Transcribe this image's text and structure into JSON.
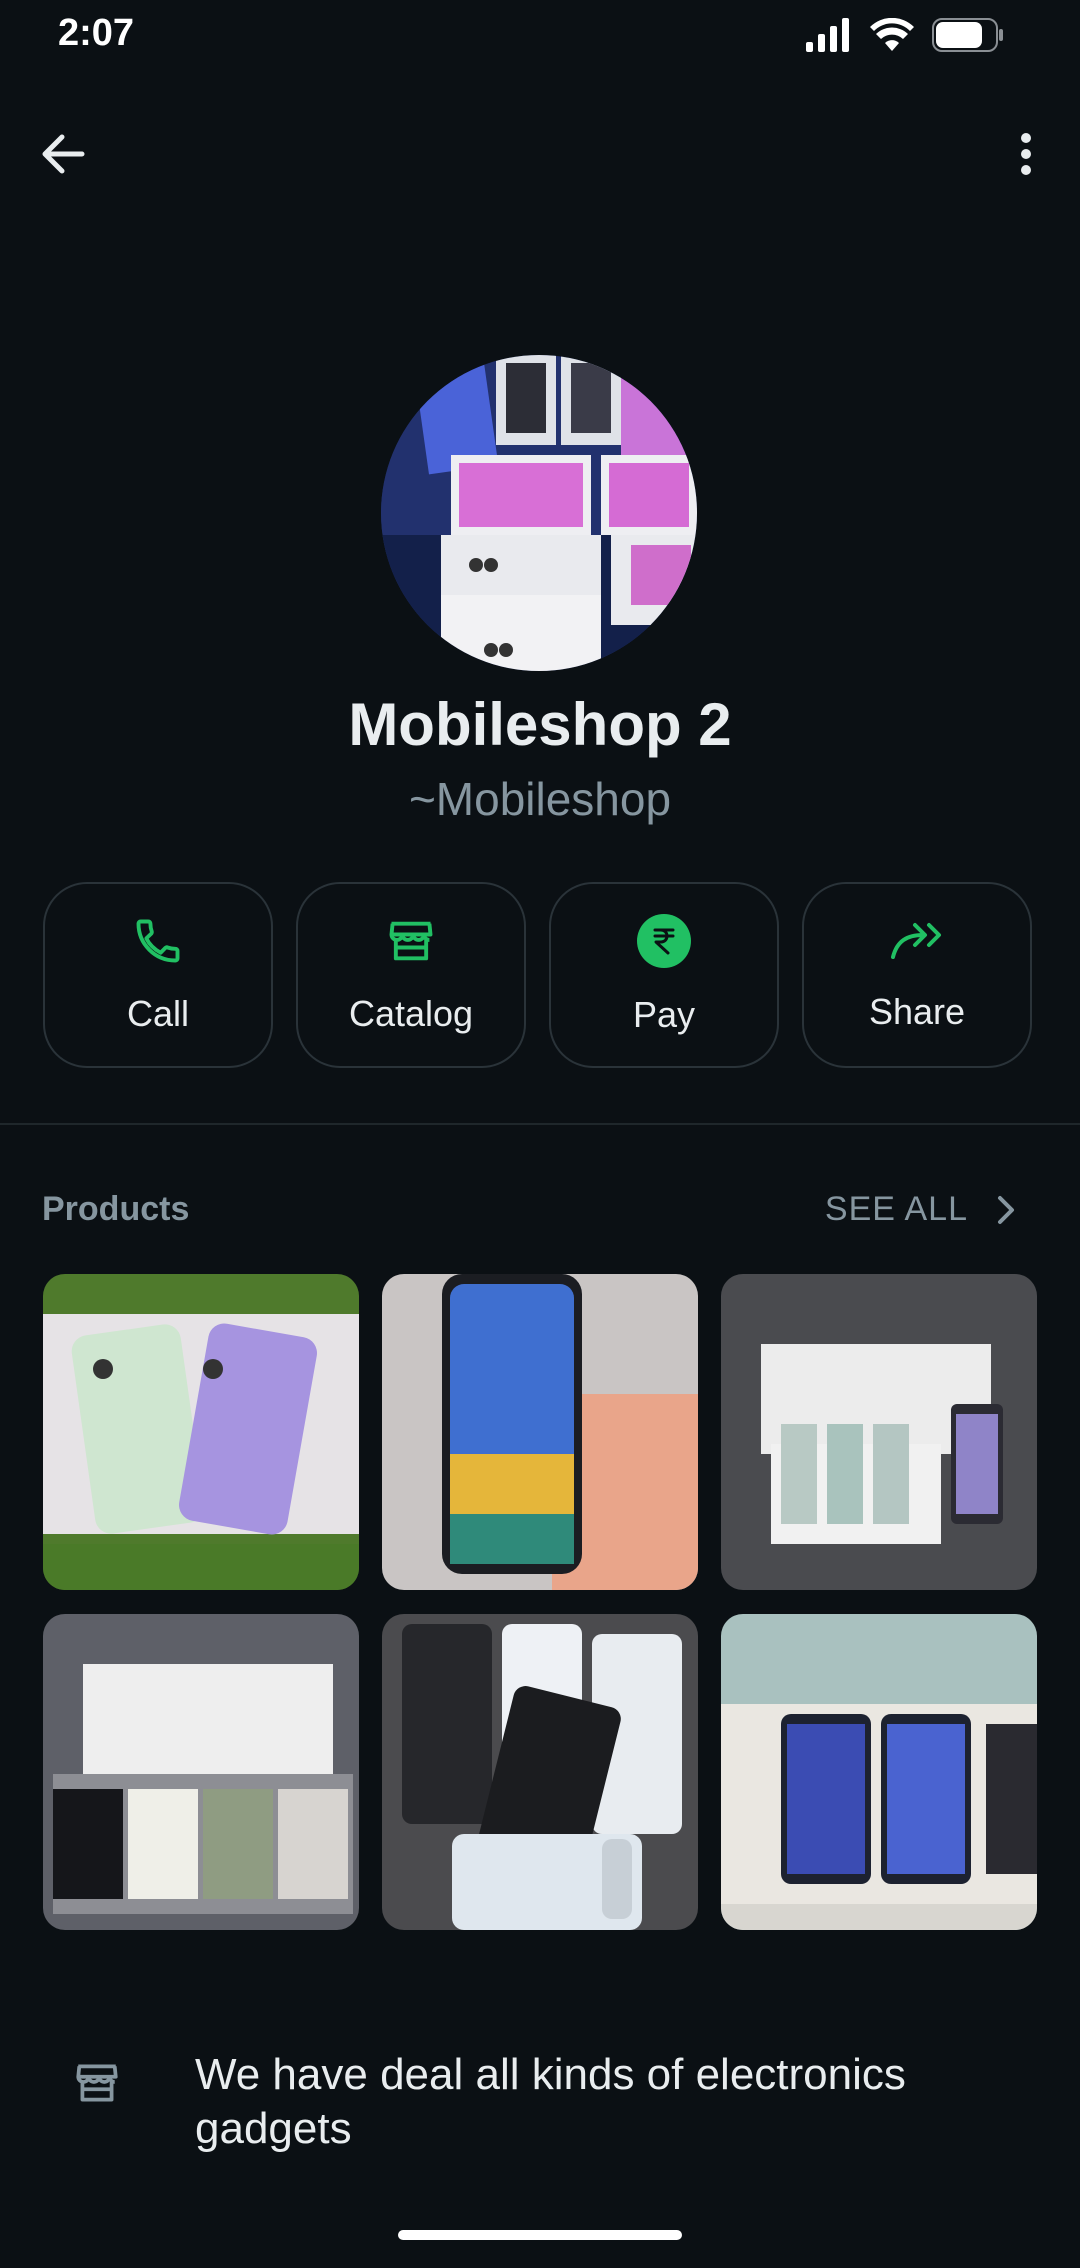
{
  "status_bar": {
    "time": "2:07"
  },
  "profile": {
    "name": "Mobileshop 2",
    "subtitle": "~Mobileshop"
  },
  "actions": [
    {
      "label": "Call",
      "icon": "phone-icon"
    },
    {
      "label": "Catalog",
      "icon": "store-icon"
    },
    {
      "label": "Pay",
      "icon": "rupee-icon"
    },
    {
      "label": "Share",
      "icon": "share-icon"
    }
  ],
  "products": {
    "title": "Products",
    "see_all": "SEE ALL",
    "items": [
      {
        "icon": "product-image"
      },
      {
        "icon": "product-image"
      },
      {
        "icon": "product-image"
      },
      {
        "icon": "product-image"
      },
      {
        "icon": "product-image"
      },
      {
        "icon": "product-image"
      }
    ]
  },
  "description": {
    "icon": "store-icon",
    "text": "We have deal all kinds of electronics gadgets"
  },
  "colors": {
    "background": "#0b1014",
    "accent": "#21c063",
    "muted_text": "#8696a0",
    "text": "#e9edef"
  }
}
